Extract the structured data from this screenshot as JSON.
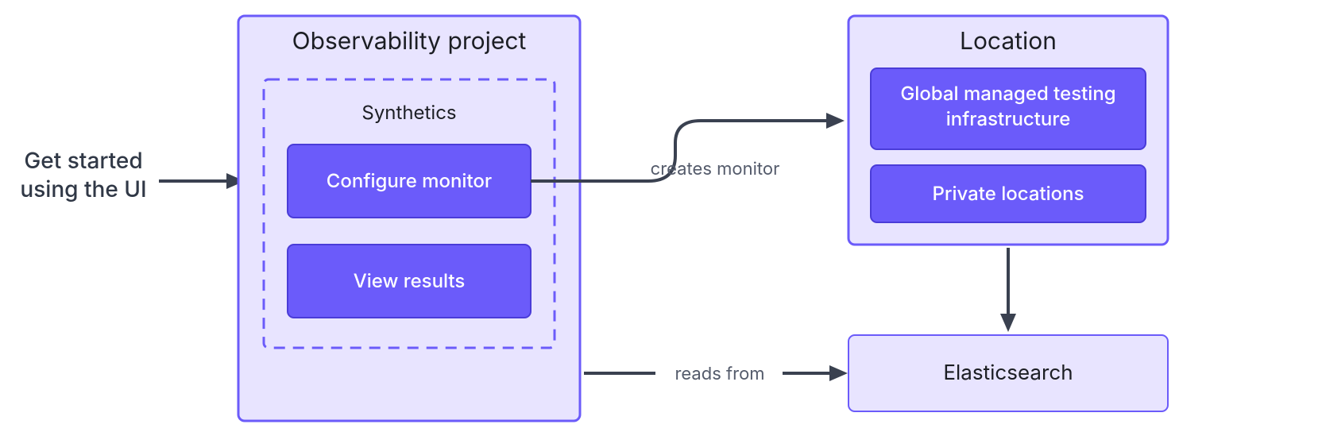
{
  "starter": {
    "line1": "Get started",
    "line2": "using the UI"
  },
  "observability": {
    "title": "Observability project",
    "synthetics_title": "Synthetics",
    "configure_label": "Configure monitor",
    "view_label": "View results"
  },
  "location": {
    "title": "Location",
    "global_line1": "Global managed testing",
    "global_line2": "infrastructure",
    "private_label": "Private locations"
  },
  "elasticsearch": {
    "label": "Elasticsearch"
  },
  "edges": {
    "creates": "creates monitor",
    "reads": "reads from"
  },
  "colors": {
    "panel_bg": "#e8e4ff",
    "panel_border": "#6b5bfa",
    "button_bg": "#6b5bfa",
    "button_border": "#4a3cd8",
    "text_dark": "#1c1e24",
    "text_starter": "#303846",
    "arrow": "#3a4150"
  }
}
